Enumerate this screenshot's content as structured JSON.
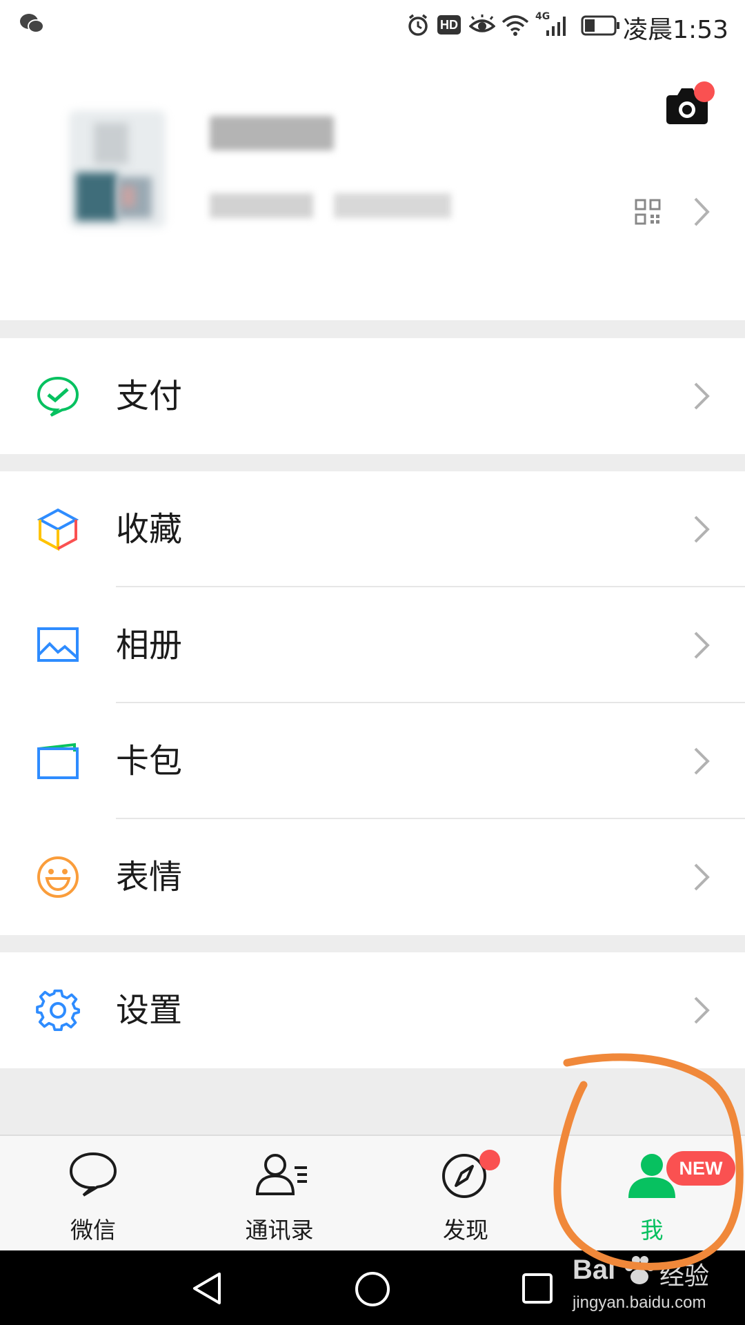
{
  "status_bar": {
    "time": "凌晨1:53",
    "hd": "HD",
    "network": "4G"
  },
  "profile": {
    "camera_badge": true
  },
  "menu": {
    "pay": "支付",
    "favorites": "收藏",
    "album": "相册",
    "cards": "卡包",
    "stickers": "表情",
    "settings": "设置"
  },
  "tabs": {
    "chats": "微信",
    "contacts": "通讯录",
    "discover": "发现",
    "me": "我",
    "me_badge": "NEW"
  },
  "watermark": {
    "brand": "Bai",
    "brand_cn": "经验",
    "url": "jingyan.baidu.com"
  },
  "colors": {
    "accent_green": "#07c160",
    "badge_red": "#fa5151",
    "annotation_orange": "#f0883a"
  }
}
